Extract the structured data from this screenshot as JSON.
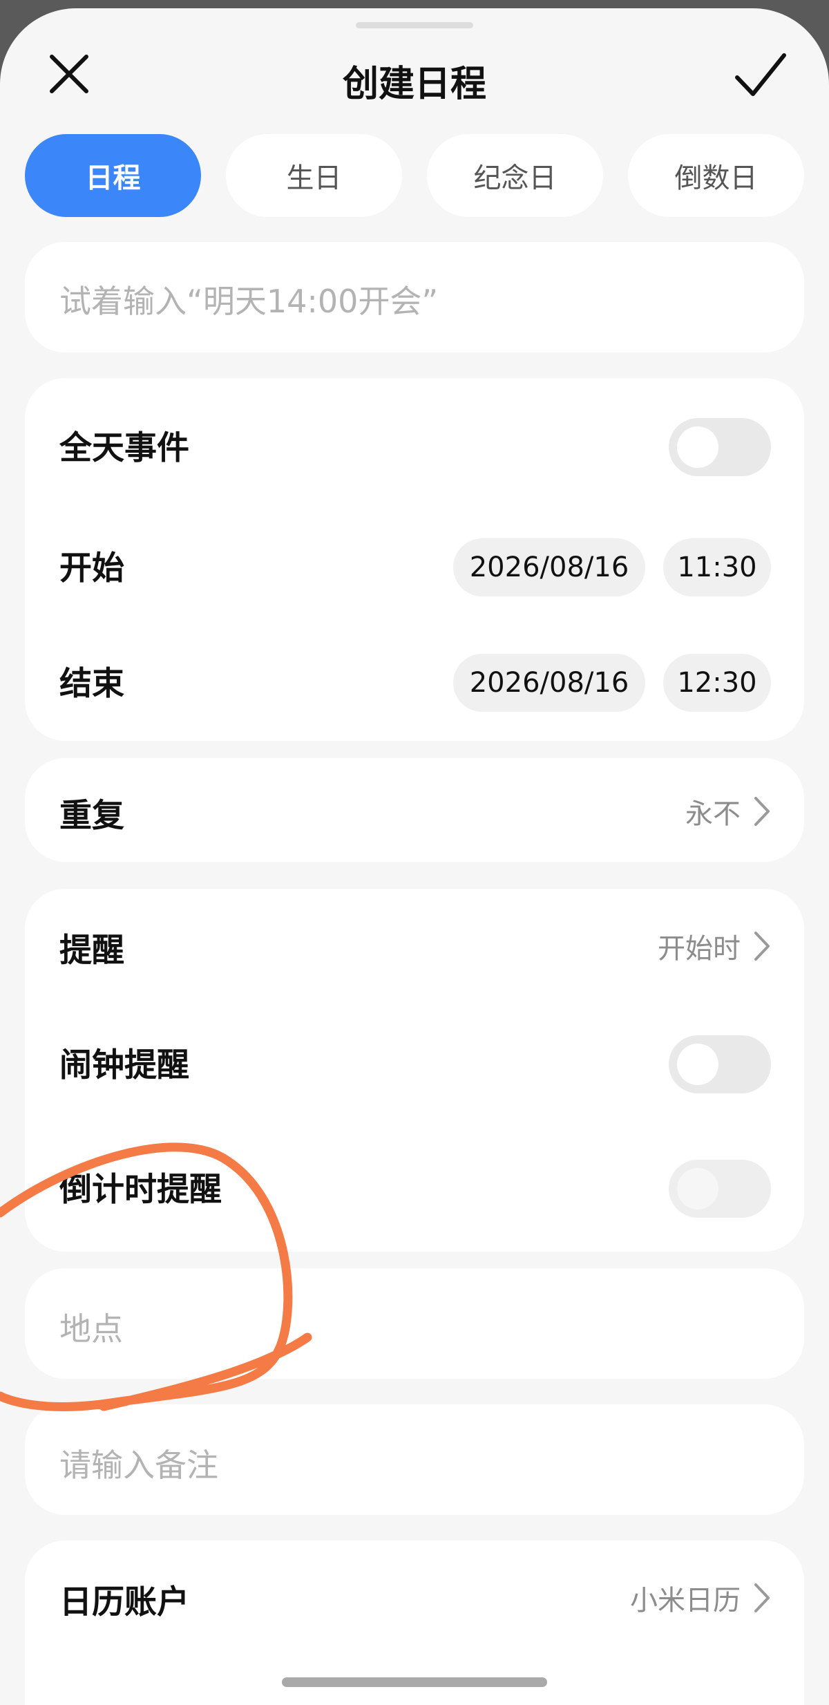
{
  "header": {
    "title": "创建日程",
    "close_icon": "close-icon",
    "confirm_icon": "check-icon"
  },
  "tabs": [
    {
      "label": "日程",
      "active": true
    },
    {
      "label": "生日",
      "active": false
    },
    {
      "label": "纪念日",
      "active": false
    },
    {
      "label": "倒数日",
      "active": false
    }
  ],
  "quick_input": {
    "placeholder": "试着输入“明天14:00开会”"
  },
  "time_card": {
    "all_day_label": "全天事件",
    "all_day_on": false,
    "start_label": "开始",
    "start_date": "2026/08/16",
    "start_time": "11:30",
    "end_label": "结束",
    "end_date": "2026/08/16",
    "end_time": "12:30"
  },
  "repeat": {
    "label": "重复",
    "value": "永不"
  },
  "reminder_card": {
    "reminder_label": "提醒",
    "reminder_value": "开始时",
    "alarm_label": "闹钟提醒",
    "alarm_on": false,
    "countdown_label": "倒计时提醒",
    "countdown_on": false
  },
  "location": {
    "placeholder": "地点"
  },
  "note": {
    "placeholder": "请输入备注"
  },
  "account": {
    "label": "日历账户",
    "value": "小米日历"
  },
  "colors": {
    "accent": "#3b86f8",
    "annotation": "#f47b45",
    "background": "#f6f6f6"
  }
}
